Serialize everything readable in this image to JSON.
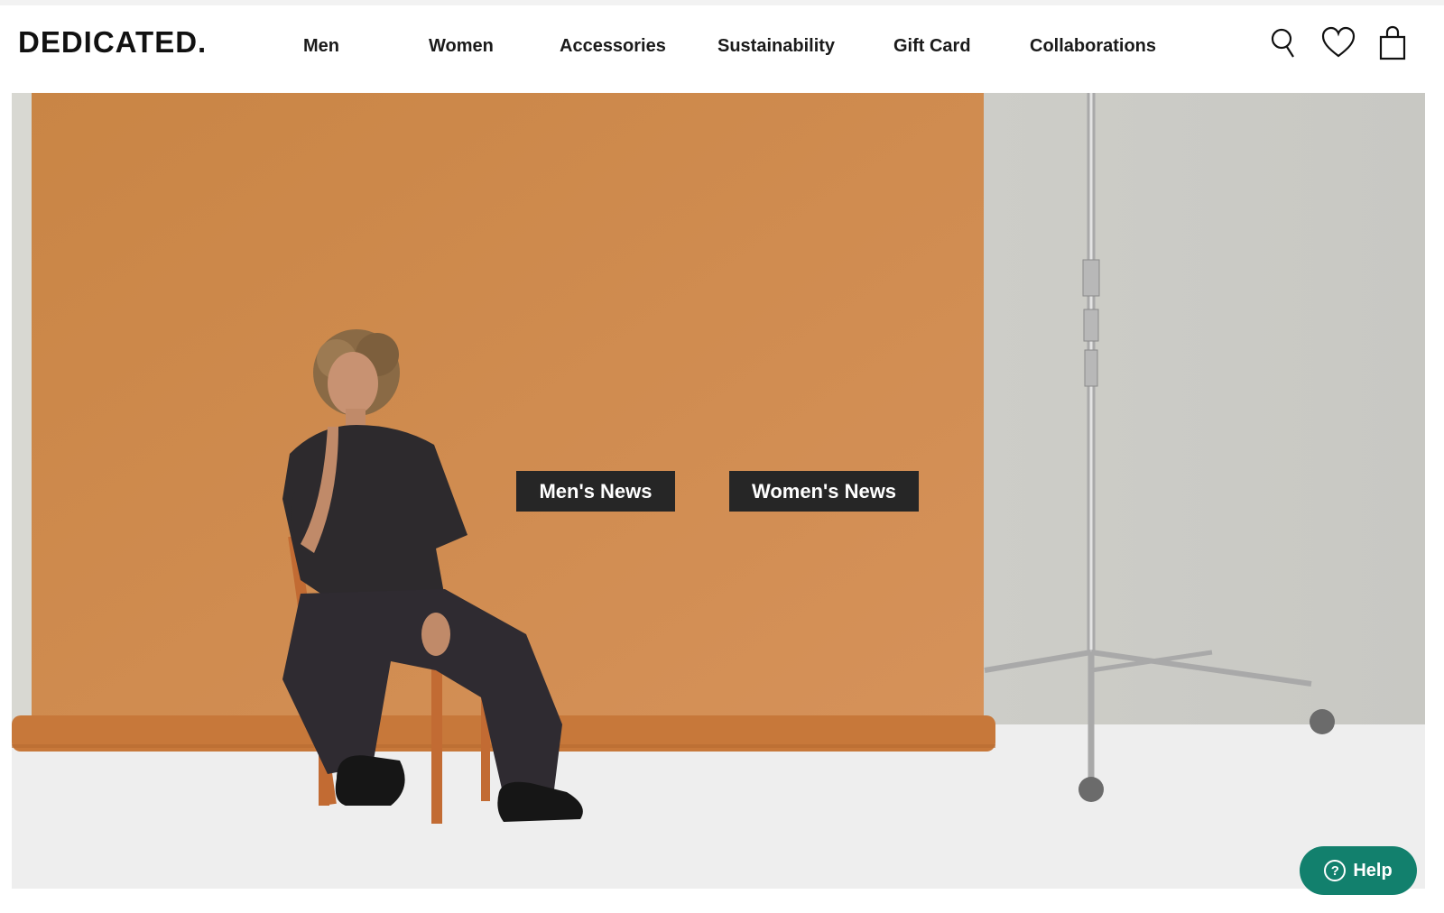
{
  "brand": {
    "logo_text": "DEDICATED."
  },
  "nav": {
    "items": [
      {
        "label": "Men"
      },
      {
        "label": "Women"
      },
      {
        "label": "Accessories"
      },
      {
        "label": "Sustainability"
      },
      {
        "label": "Gift Card"
      },
      {
        "label": "Collaborations"
      }
    ]
  },
  "header_icons": [
    "search-icon",
    "heart-icon",
    "shopping-bag-icon"
  ],
  "hero": {
    "buttons": {
      "men_label": "Men's News",
      "women_label": "Women's News"
    }
  },
  "help": {
    "label": "Help",
    "icon_glyph": "?"
  },
  "colors": {
    "backdrop_orange": "#cf8a4b",
    "button_dark": "#262626",
    "help_green": "#12806d"
  }
}
